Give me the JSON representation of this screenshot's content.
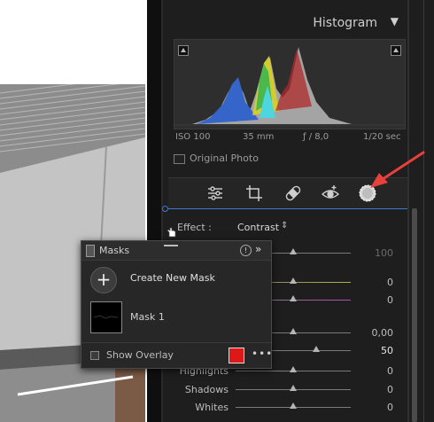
{
  "histogram": {
    "title": "Histogram",
    "collapse_icon": "triangle-down-icon",
    "exif": {
      "iso": "ISO 100",
      "focal": "35 mm",
      "aperture": "ƒ / 8,0",
      "shutter": "1/20 sec"
    },
    "original_photo_label": "Original Photo"
  },
  "tools": [
    "sliders-icon",
    "crop-icon",
    "healing-icon",
    "redeye-icon",
    "masking-icon"
  ],
  "effect": {
    "label": "Effect :",
    "value": "Contrast"
  },
  "sliders": [
    {
      "label": "",
      "value": "100",
      "dim": true,
      "pos": 0.5
    },
    {
      "label": "",
      "value": "0",
      "pos": 0.5
    },
    {
      "label": "",
      "value": "0",
      "pos": 0.5
    },
    {
      "label": "",
      "value": "0,00",
      "pos": 0.5
    },
    {
      "label": "",
      "value": "50",
      "bright": true,
      "pos": 0.7
    },
    {
      "label": "Highlights",
      "value": "0",
      "pos": 0.5
    },
    {
      "label": "Shadows",
      "value": "0",
      "pos": 0.5
    },
    {
      "label": "Whites",
      "value": "0",
      "pos": 0.5
    }
  ],
  "masks_panel": {
    "title": "Masks",
    "create_label": "Create New Mask",
    "mask_name": "Mask 1",
    "show_overlay_label": "Show Overlay",
    "overlay_color": "#e01717",
    "more_label": "•••"
  },
  "accent_colors": {
    "selection": "#3d79d0",
    "arrow": "#e8403a"
  }
}
